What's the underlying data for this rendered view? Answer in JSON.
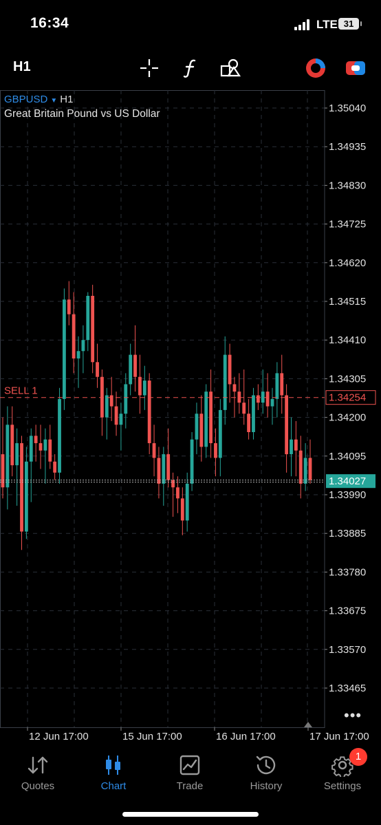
{
  "status_bar": {
    "time": "16:34",
    "network": "LTE",
    "battery": "31"
  },
  "toolbar": {
    "timeframe": "H1",
    "icons": [
      "crosshair-icon",
      "indicator-icon",
      "objects-icon",
      "market-icon",
      "trade-toggle-icon"
    ]
  },
  "chart": {
    "symbol": "GBPUSD",
    "timeframe": "H1",
    "description": "Great Britain Pound vs US Dollar",
    "sell_label": "SELL 1",
    "sell_price": "1.34254",
    "bid_price": "1.34027",
    "more_label": "•••"
  },
  "chart_data": {
    "type": "candlestick",
    "symbol": "GBPUSD",
    "ylim": [
      1.3336,
      1.3513
    ],
    "y_ticks": [
      "1.35040",
      "1.34935",
      "1.34830",
      "1.34725",
      "1.34620",
      "1.34515",
      "1.34410",
      "1.34305",
      "1.34200",
      "1.34095",
      "1.33990",
      "1.33885",
      "1.33780",
      "1.33675",
      "1.33570",
      "1.33465"
    ],
    "x_ticks": [
      "12 Jun 17:00",
      "15 Jun 17:00",
      "16 Jun 17:00",
      "17 Jun 17:00"
    ],
    "grid": true,
    "sell_line": 1.34254,
    "bid_line": 1.34027,
    "up_color": "#26a69a",
    "down_color": "#ef5350",
    "candles": [
      [
        1.341,
        1.342,
        1.3398,
        1.3401
      ],
      [
        1.3401,
        1.3423,
        1.3395,
        1.3418
      ],
      [
        1.3418,
        1.3423,
        1.3404,
        1.3407
      ],
      [
        1.3407,
        1.3417,
        1.3396,
        1.3413
      ],
      [
        1.3413,
        1.3415,
        1.3384,
        1.3389
      ],
      [
        1.3389,
        1.3412,
        1.3387,
        1.3408
      ],
      [
        1.3408,
        1.3417,
        1.3397,
        1.3415
      ],
      [
        1.3415,
        1.3418,
        1.3408,
        1.3413
      ],
      [
        1.3413,
        1.3418,
        1.3406,
        1.3411
      ],
      [
        1.3411,
        1.3417,
        1.3402,
        1.3414
      ],
      [
        1.3414,
        1.3418,
        1.3406,
        1.3408
      ],
      [
        1.3408,
        1.341,
        1.3403,
        1.3405
      ],
      [
        1.3405,
        1.3428,
        1.3402,
        1.3425
      ],
      [
        1.3425,
        1.3455,
        1.3422,
        1.3452
      ],
      [
        1.3452,
        1.3457,
        1.3445,
        1.3448
      ],
      [
        1.3448,
        1.3454,
        1.3432,
        1.3436
      ],
      [
        1.3436,
        1.3442,
        1.3428,
        1.3438
      ],
      [
        1.3438,
        1.3445,
        1.3432,
        1.3441
      ],
      [
        1.3441,
        1.3454,
        1.3438,
        1.3453
      ],
      [
        1.3453,
        1.3456,
        1.3432,
        1.3435
      ],
      [
        1.3435,
        1.344,
        1.3428,
        1.3431
      ],
      [
        1.3431,
        1.3433,
        1.3415,
        1.342
      ],
      [
        1.342,
        1.3428,
        1.3414,
        1.3426
      ],
      [
        1.3426,
        1.3431,
        1.3419,
        1.3423
      ],
      [
        1.3423,
        1.3427,
        1.3415,
        1.3418
      ],
      [
        1.3418,
        1.3424,
        1.3411,
        1.3421
      ],
      [
        1.3421,
        1.3432,
        1.3417,
        1.3429
      ],
      [
        1.3429,
        1.344,
        1.3426,
        1.3437
      ],
      [
        1.3437,
        1.3445,
        1.3427,
        1.3431
      ],
      [
        1.3431,
        1.3437,
        1.3421,
        1.3426
      ],
      [
        1.3426,
        1.3434,
        1.3422,
        1.343
      ],
      [
        1.343,
        1.3432,
        1.341,
        1.3413
      ],
      [
        1.3413,
        1.3418,
        1.3404,
        1.3409
      ],
      [
        1.3409,
        1.3412,
        1.3398,
        1.3402
      ],
      [
        1.3402,
        1.3412,
        1.3396,
        1.341
      ],
      [
        1.341,
        1.3417,
        1.3401,
        1.3403
      ],
      [
        1.3403,
        1.3405,
        1.3393,
        1.3401
      ],
      [
        1.3401,
        1.3404,
        1.3394,
        1.3398
      ],
      [
        1.3398,
        1.3401,
        1.3388,
        1.3392
      ],
      [
        1.3392,
        1.3405,
        1.3389,
        1.3402
      ],
      [
        1.3402,
        1.3416,
        1.34,
        1.3414
      ],
      [
        1.3414,
        1.3424,
        1.341,
        1.3421
      ],
      [
        1.3421,
        1.3426,
        1.3408,
        1.3412
      ],
      [
        1.3412,
        1.3429,
        1.3409,
        1.3427
      ],
      [
        1.3427,
        1.3433,
        1.3409,
        1.3413
      ],
      [
        1.3413,
        1.3417,
        1.3404,
        1.3409
      ],
      [
        1.3409,
        1.3425,
        1.3404,
        1.3422
      ],
      [
        1.3422,
        1.3442,
        1.3418,
        1.3437
      ],
      [
        1.3437,
        1.344,
        1.3424,
        1.3429
      ],
      [
        1.3429,
        1.3431,
        1.342,
        1.3427
      ],
      [
        1.3427,
        1.3432,
        1.3421,
        1.3424
      ],
      [
        1.3424,
        1.3433,
        1.3418,
        1.3421
      ],
      [
        1.3421,
        1.3425,
        1.3414,
        1.3416
      ],
      [
        1.3416,
        1.3428,
        1.3414,
        1.3426
      ],
      [
        1.3426,
        1.3429,
        1.3422,
        1.3424
      ],
      [
        1.3424,
        1.3433,
        1.3421,
        1.3427
      ],
      [
        1.3427,
        1.3432,
        1.342,
        1.3423
      ],
      [
        1.3423,
        1.3428,
        1.3418,
        1.3425
      ],
      [
        1.3425,
        1.3435,
        1.342,
        1.3432
      ],
      [
        1.3432,
        1.3437,
        1.3421,
        1.3426
      ],
      [
        1.3426,
        1.3429,
        1.3405,
        1.341
      ],
      [
        1.341,
        1.342,
        1.3404,
        1.3414
      ],
      [
        1.3414,
        1.3419,
        1.3404,
        1.3411
      ],
      [
        1.3411,
        1.3415,
        1.3398,
        1.3402
      ],
      [
        1.3402,
        1.3413,
        1.34,
        1.3409
      ],
      [
        1.3409,
        1.3414,
        1.3402,
        1.3403
      ]
    ]
  },
  "tabs": [
    {
      "label": "Quotes",
      "icon": "quotes-icon",
      "active": false
    },
    {
      "label": "Chart",
      "icon": "chart-icon",
      "active": true
    },
    {
      "label": "Trade",
      "icon": "trade-icon",
      "active": false
    },
    {
      "label": "History",
      "icon": "history-icon",
      "active": false
    },
    {
      "label": "Settings",
      "icon": "settings-icon",
      "active": false
    }
  ],
  "settings_badge": "1",
  "colors": {
    "accent": "#2e8be6",
    "sell_line": "#ef5350",
    "bid_box": "#26a69a",
    "grid": "#2a2f38"
  }
}
